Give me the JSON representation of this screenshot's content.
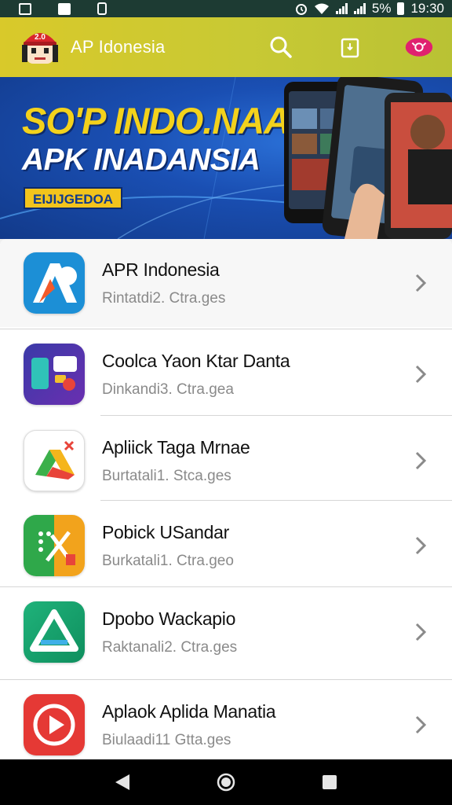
{
  "status_bar": {
    "time": "19:30",
    "battery": "5%",
    "icons": [
      "image-icon",
      "image-icon",
      "battery-saver-icon",
      "alarm-icon",
      "wifi-icon",
      "signal-icon",
      "signal-icon",
      "battery-icon"
    ]
  },
  "app_bar": {
    "title": "AP Idonesia",
    "logo_badge": "2.0",
    "icons": [
      "search-icon",
      "share-icon",
      "cast-icon"
    ],
    "color": "#d4c82c"
  },
  "banner": {
    "line1": "SO'P INDO.NAA!",
    "line2": "APK INADANSIA",
    "badge": "EIJIJGEDOA"
  },
  "apps": [
    {
      "title": "APR Indonesia",
      "subtitle": "Rintatdi2. Ctra.ges",
      "icon": "a-logo-icon",
      "color": "#1c8fd6"
    },
    {
      "title": "Coolca Yaon Ktar Danta",
      "subtitle": "Dinkandi3. Ctra.gea",
      "icon": "chat-app-icon",
      "color": "#3a3aa8"
    },
    {
      "title": "Apliick Taga Mrnae",
      "subtitle": "Burtatali1. Stca.ges",
      "icon": "drive-logo-icon",
      "color": "#ffffff"
    },
    {
      "title": "Pobick USandar",
      "subtitle": "Burkatali1. Ctra.geo",
      "icon": "tools-app-icon",
      "color": "#f2a31c"
    },
    {
      "title": "Dpobo Wackapio",
      "subtitle": "Raktanali2. Ctra.ges",
      "icon": "triangle-logo-icon",
      "color": "#17a86a"
    },
    {
      "title": "Aplaok Aplida Manatia",
      "subtitle": "Biulaadi11 Gtta.ges",
      "icon": "play-logo-icon",
      "color": "#e53935"
    }
  ],
  "nav_bar": {
    "icons": [
      "back-icon",
      "home-icon",
      "recents-icon"
    ]
  }
}
